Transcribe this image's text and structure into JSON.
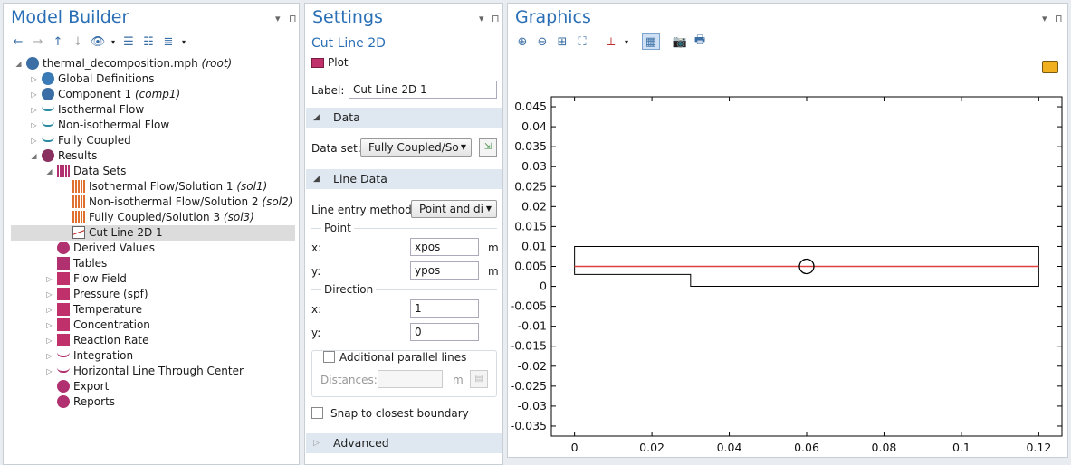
{
  "model_builder": {
    "title": "Model Builder",
    "tree": [
      {
        "label": "thermal_decomposition.mph",
        "tag": "(root)",
        "icon": "model-root-icon",
        "level": 0,
        "twisty": "open"
      },
      {
        "label": "Global Definitions",
        "tag": "",
        "icon": "globe-icon",
        "level": 1,
        "twisty": "closed"
      },
      {
        "label": "Component 1",
        "tag": "(comp1)",
        "icon": "component-icon",
        "level": 1,
        "twisty": "closed"
      },
      {
        "label": "Isothermal Flow",
        "tag": "",
        "icon": "study-icon",
        "level": 1,
        "twisty": "closed"
      },
      {
        "label": "Non-isothermal Flow",
        "tag": "",
        "icon": "study-icon",
        "level": 1,
        "twisty": "closed"
      },
      {
        "label": "Fully Coupled",
        "tag": "",
        "icon": "study-icon",
        "level": 1,
        "twisty": "closed"
      },
      {
        "label": "Results",
        "tag": "",
        "icon": "results-icon",
        "level": 1,
        "twisty": "open"
      },
      {
        "label": "Data Sets",
        "tag": "",
        "icon": "datasets-icon",
        "level": 2,
        "twisty": "open"
      },
      {
        "label": "Isothermal Flow/Solution 1",
        "tag": "(sol1)",
        "icon": "solution-icon",
        "level": 3,
        "twisty": ""
      },
      {
        "label": "Non-isothermal Flow/Solution 2",
        "tag": "(sol2)",
        "icon": "solution-icon",
        "level": 3,
        "twisty": ""
      },
      {
        "label": "Fully Coupled/Solution 3",
        "tag": "(sol3)",
        "icon": "solution-icon",
        "level": 3,
        "twisty": ""
      },
      {
        "label": "Cut Line 2D 1",
        "tag": "",
        "icon": "cutline-icon",
        "level": 3,
        "twisty": "",
        "selected": true
      },
      {
        "label": "Derived Values",
        "tag": "",
        "icon": "derived-values-icon",
        "level": 2,
        "twisty": ""
      },
      {
        "label": "Tables",
        "tag": "",
        "icon": "table-icon",
        "level": 2,
        "twisty": ""
      },
      {
        "label": "Flow Field",
        "tag": "",
        "icon": "plotgroup-icon",
        "level": 2,
        "twisty": "closed"
      },
      {
        "label": "Pressure (spf)",
        "tag": "",
        "icon": "plotgroup-icon",
        "level": 2,
        "twisty": "closed"
      },
      {
        "label": "Temperature",
        "tag": "",
        "icon": "plotgroup-icon",
        "level": 2,
        "twisty": "closed"
      },
      {
        "label": "Concentration",
        "tag": "",
        "icon": "plotgroup-icon",
        "level": 2,
        "twisty": "closed"
      },
      {
        "label": "Reaction Rate",
        "tag": "",
        "icon": "plotgroup-icon",
        "level": 2,
        "twisty": "closed"
      },
      {
        "label": "Integration",
        "tag": "",
        "icon": "lineplot-icon",
        "level": 2,
        "twisty": "closed"
      },
      {
        "label": "Horizontal Line Through Center",
        "tag": "",
        "icon": "lineplot-icon",
        "level": 2,
        "twisty": "closed"
      },
      {
        "label": "Export",
        "tag": "",
        "icon": "export-icon",
        "level": 2,
        "twisty": ""
      },
      {
        "label": "Reports",
        "tag": "",
        "icon": "reports-icon",
        "level": 2,
        "twisty": ""
      }
    ]
  },
  "settings": {
    "title": "Settings",
    "node_title": "Cut Line 2D",
    "plot_button": "Plot",
    "label_caption": "Label:",
    "label_value": "Cut Line 2D 1",
    "data_section": "Data",
    "dataset_caption": "Data set:",
    "dataset_value": "Fully Coupled/So",
    "line_data_section": "Line Data",
    "line_entry_caption": "Line entry method:",
    "line_entry_value": "Point and di",
    "point_group": "Point",
    "point_x_caption": "x:",
    "point_x_value": "xpos",
    "point_x_unit": "m",
    "point_y_caption": "y:",
    "point_y_value": "ypos",
    "point_y_unit": "m",
    "direction_group": "Direction",
    "dir_x_caption": "x:",
    "dir_x_value": "1",
    "dir_y_caption": "y:",
    "dir_y_value": "0",
    "parallel_lines_caption": "Additional parallel lines",
    "distances_caption": "Distances:",
    "distances_unit": "m",
    "snap_caption": "Snap to closest boundary",
    "advanced_section": "Advanced"
  },
  "graphics": {
    "title": "Graphics",
    "toolbar_icons": [
      "zoom-in-icon",
      "zoom-out-icon",
      "zoom-box-icon",
      "zoom-extents-icon",
      "axis-orientation-icon",
      "grid-icon",
      "camera-icon",
      "print-icon"
    ]
  },
  "chart_data": {
    "type": "geometry-plot",
    "xlim": [
      -0.006,
      0.126
    ],
    "ylim": [
      -0.0375,
      0.0475
    ],
    "x_ticks": [
      "0",
      "0.02",
      "0.04",
      "0.06",
      "0.08",
      "0.1",
      "0.12"
    ],
    "x_tick_values": [
      0,
      0.02,
      0.04,
      0.06,
      0.08,
      0.1,
      0.12
    ],
    "y_ticks": [
      "0.045",
      "0.04",
      "0.035",
      "0.03",
      "0.025",
      "0.02",
      "0.015",
      "0.01",
      "0.005",
      "0",
      "-0.005",
      "-0.01",
      "-0.015",
      "-0.02",
      "-0.025",
      "-0.03",
      "-0.035"
    ],
    "y_tick_values": [
      0.045,
      0.04,
      0.035,
      0.03,
      0.025,
      0.02,
      0.015,
      0.01,
      0.005,
      0,
      -0.005,
      -0.01,
      -0.015,
      -0.02,
      -0.025,
      -0.03,
      -0.035
    ],
    "geometry_outline": [
      [
        0,
        0.01
      ],
      [
        0.12,
        0.01
      ],
      [
        0.12,
        0
      ],
      [
        0.03,
        0
      ],
      [
        0.03,
        0.003
      ],
      [
        0,
        0.003
      ]
    ],
    "cut_line": {
      "x": [
        0,
        0.12
      ],
      "y": 0.005,
      "color": "#e04040"
    },
    "cut_point": {
      "x": 0.06,
      "y": 0.005
    }
  },
  "colors": {
    "accent": "#2a6fb5",
    "section_bg": "#dfe8f1",
    "cut_line": "#e04040"
  }
}
